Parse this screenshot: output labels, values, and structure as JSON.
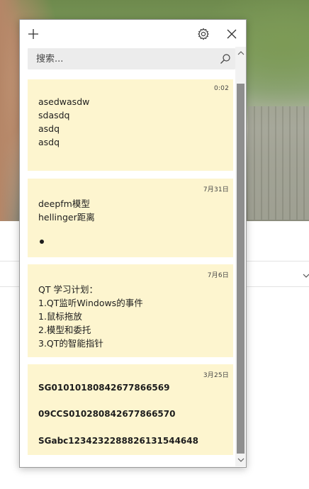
{
  "window": {
    "icons": {
      "add": "plus-icon",
      "settings": "gear-icon",
      "close": "close-icon",
      "search": "search-icon"
    },
    "search": {
      "placeholder": "搜索...",
      "value": ""
    }
  },
  "notes": [
    {
      "date": "0:02",
      "lines": [
        "asedwasdw",
        "sdasdq",
        "asdq",
        "asdq"
      ]
    },
    {
      "date": "7月31日",
      "lines": [
        "deepfm模型",
        "hellinger距离"
      ],
      "bullet_items": [
        ""
      ]
    },
    {
      "date": "7月6日",
      "lines": [
        "QT 学习计划：",
        "1.QT监听Windows的事件",
        "1.鼠标拖放",
        "2.模型和委托",
        "3.QT的智能指针"
      ]
    },
    {
      "date": "3月25日",
      "lines": [
        "SG01010180842677866569",
        "09CCS010280842677866570",
        "SGabc12342322888261315446​48"
      ]
    }
  ],
  "colors": {
    "note_background": "#fdf5cf",
    "scroll_thumb": "#8e8e8e",
    "search_background": "#ececec"
  }
}
